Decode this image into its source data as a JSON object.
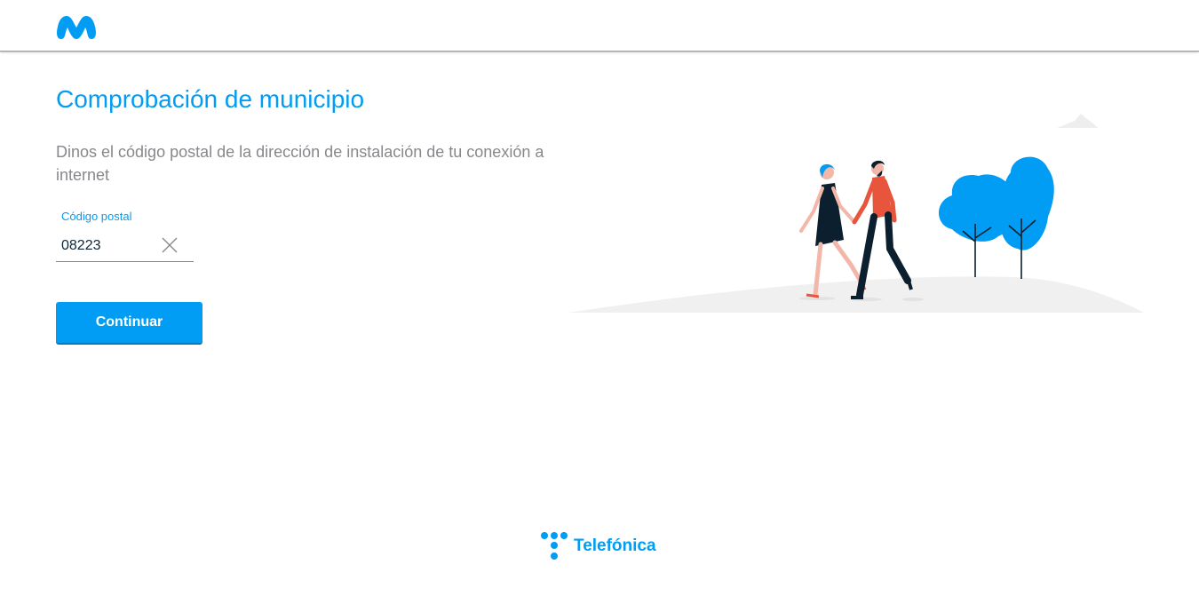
{
  "header": {
    "logo_icon": "movistar-m-logo",
    "brand_color": "#019df4"
  },
  "main": {
    "title": "Comprobación de municipio",
    "subtitle": "Dinos el código postal de la dirección de instalación de tu conexión a internet",
    "postal_field": {
      "label": "Código postal",
      "value": "08223",
      "clear_icon": "close-icon"
    },
    "continue_label": "Continuar"
  },
  "illustration": {
    "icon": "couple-walking-trees-illustration"
  },
  "footer": {
    "brand": "Telefónica",
    "logo_icon": "telefonica-dots-logo"
  }
}
